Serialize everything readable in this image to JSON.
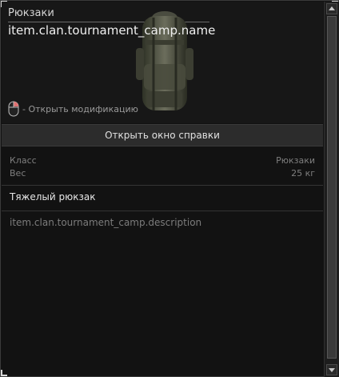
{
  "header": {
    "category": "Рюкзаки",
    "item_name": "item.clan.tournament_camp.name",
    "mouse_hint": "- Открыть модификацию"
  },
  "help_button": {
    "label": "Открыть окно справки"
  },
  "stats": [
    {
      "label": "Класс",
      "value": "Рюкзаки"
    },
    {
      "label": "Вес",
      "value": "25 кг"
    }
  ],
  "subtitle": "Тяжелый рюкзак",
  "description": "item.clan.tournament_camp.description",
  "icons": {
    "mouse": "mouse-icon",
    "item": "backpack-icon",
    "scroll_up": "arrow-up-icon",
    "scroll_down": "arrow-down-icon"
  },
  "colors": {
    "background": "#121212",
    "button": "#2c2c2c",
    "accent_mouse": "#e07070"
  }
}
